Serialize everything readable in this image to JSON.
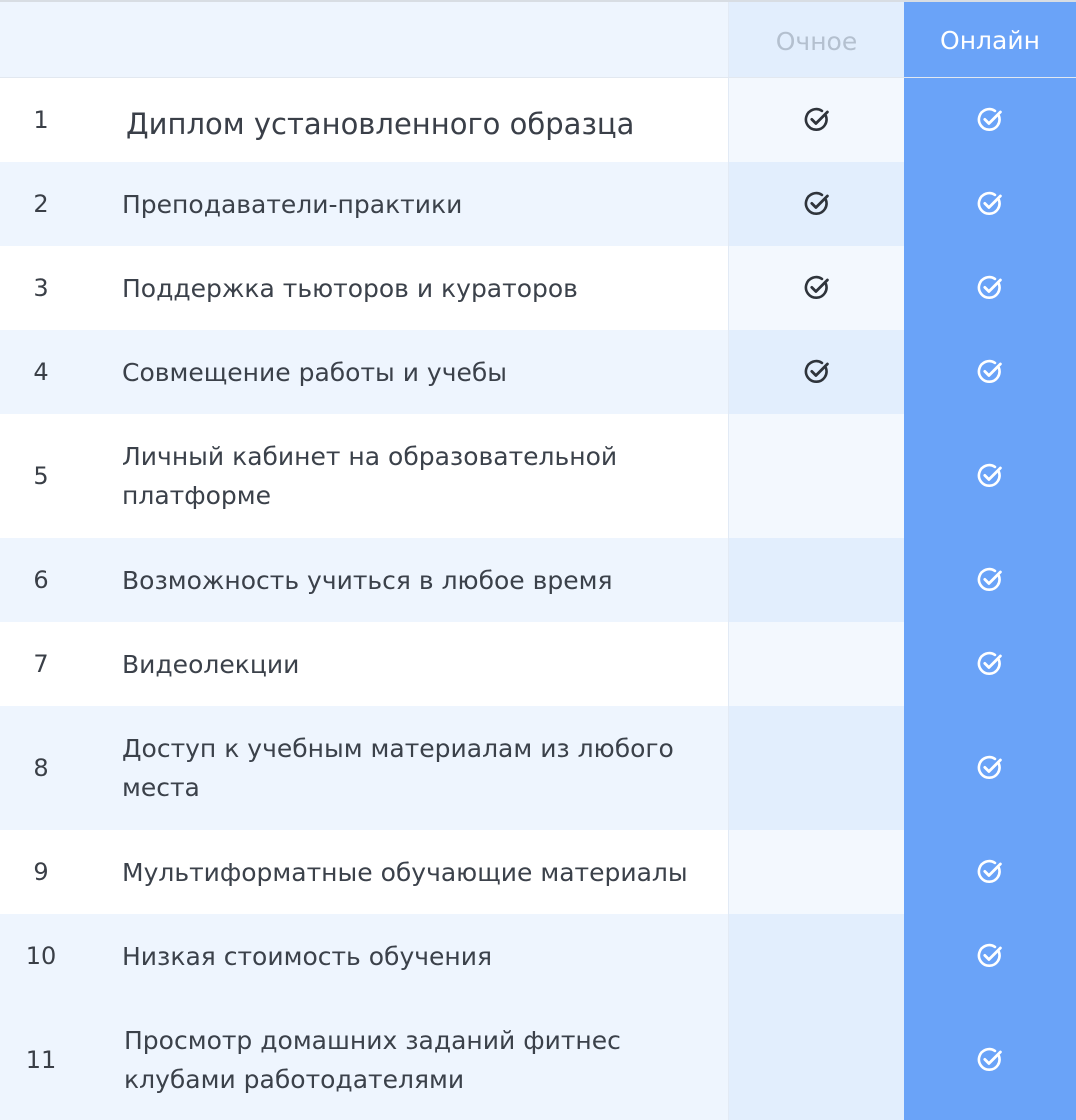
{
  "header": {
    "col_offline": "Очное",
    "col_online": "Онлайн"
  },
  "icons": {
    "check": "check-circle-icon"
  },
  "colors": {
    "online_column": "#6aa3f8",
    "row_shade": "#eef5fe",
    "check_dark": "#2f343b",
    "check_light": "#ffffff"
  },
  "rows": [
    {
      "num": "1",
      "label": "Диплом установленного образца",
      "offline": true,
      "online": true
    },
    {
      "num": "2",
      "label": "Преподаватели-практики",
      "offline": true,
      "online": true
    },
    {
      "num": "3",
      "label": "Поддержка тьюторов и кураторов",
      "offline": true,
      "online": true
    },
    {
      "num": "4",
      "label": "Совмещение работы и учебы",
      "offline": true,
      "online": true
    },
    {
      "num": "5",
      "label": "Личный кабинет на образовательной платформе",
      "offline": false,
      "online": true
    },
    {
      "num": "6",
      "label": "Возможность учиться в любое время",
      "offline": false,
      "online": true
    },
    {
      "num": "7",
      "label": "Видеолекции",
      "offline": false,
      "online": true
    },
    {
      "num": "8",
      "label": "Доступ к учебным материалам из любого места",
      "offline": false,
      "online": true
    },
    {
      "num": "9",
      "label": "Мультиформатные обучающие материалы",
      "offline": false,
      "online": true
    },
    {
      "num": "10",
      "label": "Низкая стоимость обучения",
      "offline": false,
      "online": true
    },
    {
      "num": "11",
      "label": "Просмотр домашних заданий фитнес клубами работодателями",
      "offline": false,
      "online": true
    }
  ]
}
